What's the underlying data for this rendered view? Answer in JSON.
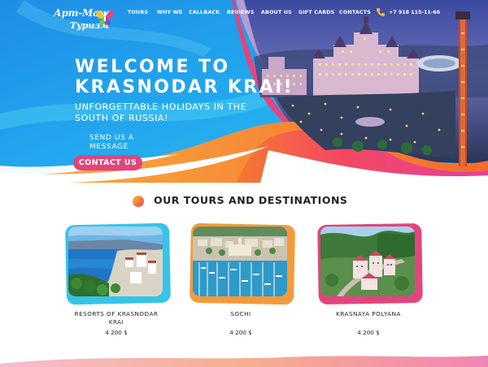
{
  "logo": {
    "line1": "Арт-Макс",
    "line2": "Туризм"
  },
  "nav": [
    "TOURS",
    "WHY WE",
    "CALLBACK",
    "REVIEWS",
    "ABOUT US",
    "GIFT CARDS",
    "CONTACTS"
  ],
  "phone": "+7 918 115-11-66",
  "hero": {
    "title_line1": "WELCOME TO",
    "title_line2": "KRASNODAR KRAI!",
    "subtitle": "UNFORGETTABLE HOLIDAYS IN THE SOUTH OF RUSSIA!",
    "send_message": "SEND US A MESSAGE",
    "contact_button": "CONTACT US"
  },
  "section": {
    "title": "OUR TOURS AND DESTINATIONS"
  },
  "cards": [
    {
      "name": "RESORTS OF KRASNODAR KRAI",
      "price": "4 200 $",
      "frame_color": "#35c4e8"
    },
    {
      "name": "SOCHI",
      "price": "4 200 $",
      "frame_color": "#f49a3a"
    },
    {
      "name": "KRASNAYA POLYANA",
      "price": "4 200 $",
      "frame_color": "#e2457e"
    }
  ],
  "colors": {
    "hero_blue": "#1e9ee8",
    "accent_pink": "#e0457c",
    "accent_orange": "#f58a35"
  }
}
